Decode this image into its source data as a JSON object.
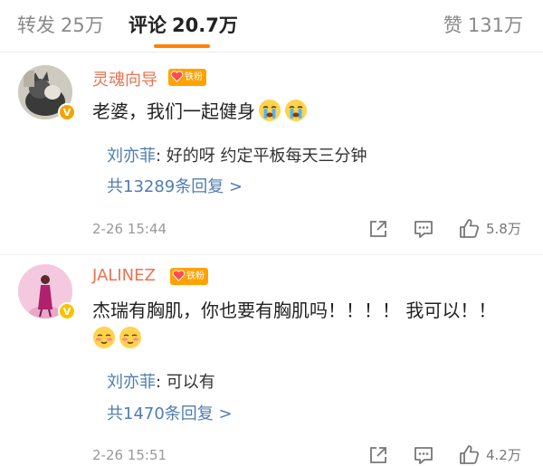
{
  "tabs": {
    "repost": {
      "label": "转发",
      "count": "25万"
    },
    "comment": {
      "label": "评论",
      "count": "20.7万"
    },
    "like": {
      "label": "赞",
      "count": "131万"
    }
  },
  "comments": [
    {
      "username": "灵魂向导",
      "fan_badge": "铁粉",
      "text": "老婆，我们一起健身",
      "emojis": [
        "crying-emoji",
        "crying-emoji"
      ],
      "reply": {
        "name": "刘亦菲",
        "text": ": 好的呀 约定平板每天三分钟"
      },
      "more_replies": "共13289条回复 >",
      "time": "2-26 15:44",
      "like_count": "5.8万"
    },
    {
      "username": "JALINEZ",
      "fan_badge": "铁粉",
      "text": "杰瑞有胸肌，你也要有胸肌吗！！！！ 我可以！！",
      "emojis": [
        "blushing-emoji",
        "blushing-emoji"
      ],
      "reply": {
        "name": "刘亦菲",
        "text": ": 可以有"
      },
      "more_replies": "共1470条回复 >",
      "time": "2-26 15:51",
      "like_count": "4.2万"
    }
  ],
  "colors": {
    "accent": "#ff8200",
    "username": "#eb7350",
    "link": "#507daf",
    "verified_orange": "#f2a400",
    "verified_yellow": "#f5c300",
    "fan_badge": "#ffa200"
  }
}
